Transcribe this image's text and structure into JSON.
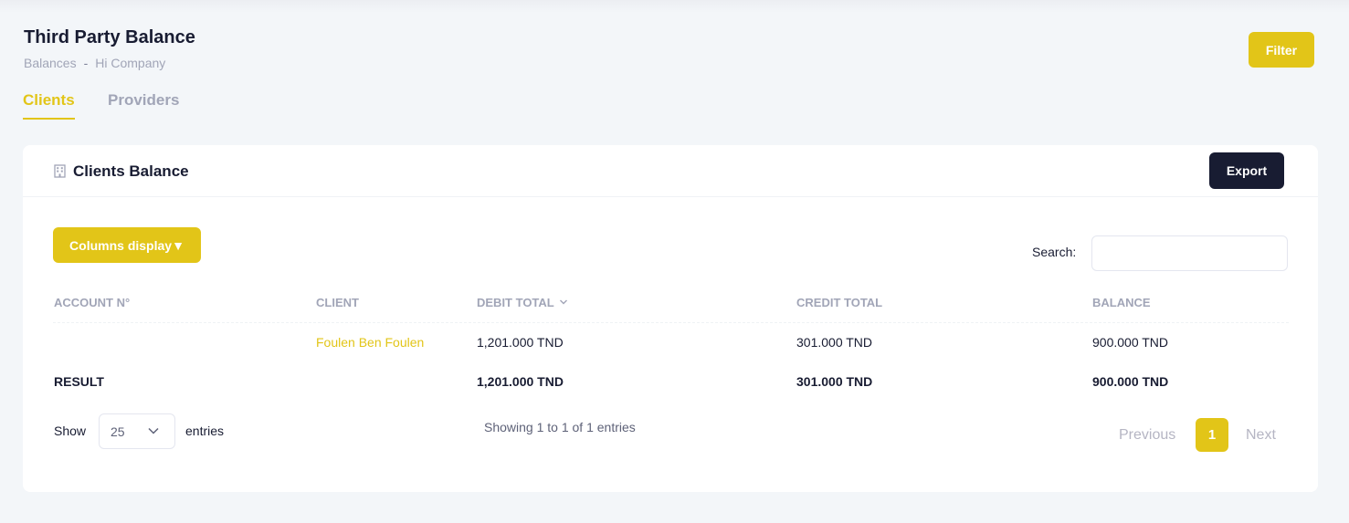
{
  "header": {
    "title": "Third Party Balance",
    "breadcrumb": [
      "Balances",
      "-",
      "Hi Company"
    ],
    "filter_label": "Filter"
  },
  "tabs": [
    {
      "label": "Clients",
      "active": true
    },
    {
      "label": "Providers",
      "active": false
    }
  ],
  "card": {
    "title": "Clients Balance",
    "icon": "building-icon",
    "export_label": "Export"
  },
  "toolbar": {
    "columns_label": "Columns display▼",
    "search_label": "Search:",
    "search_value": ""
  },
  "table": {
    "columns": [
      "ACCOUNT N°",
      "CLIENT",
      "DEBIT TOTAL",
      "CREDIT TOTAL",
      "BALANCE"
    ],
    "sorted_column": "DEBIT TOTAL",
    "rows": [
      {
        "account": "",
        "client": "Foulen Ben Foulen",
        "debit": "1,201.000 TND",
        "credit": "301.000 TND",
        "balance": "900.000 TND"
      }
    ],
    "result": {
      "label": "RESULT",
      "debit": "1,201.000 TND",
      "credit": "301.000 TND",
      "balance": "900.000 TND"
    }
  },
  "footer": {
    "show_label": "Show",
    "page_length": "25",
    "entries_label": "entries",
    "info": "Showing 1 to 1 of 1 entries",
    "previous_label": "Previous",
    "current_page": "1",
    "next_label": "Next"
  },
  "colors": {
    "accent": "#e2c518",
    "dark": "#181c32",
    "muted": "#a1a5b7",
    "background": "#f3f6f9"
  }
}
